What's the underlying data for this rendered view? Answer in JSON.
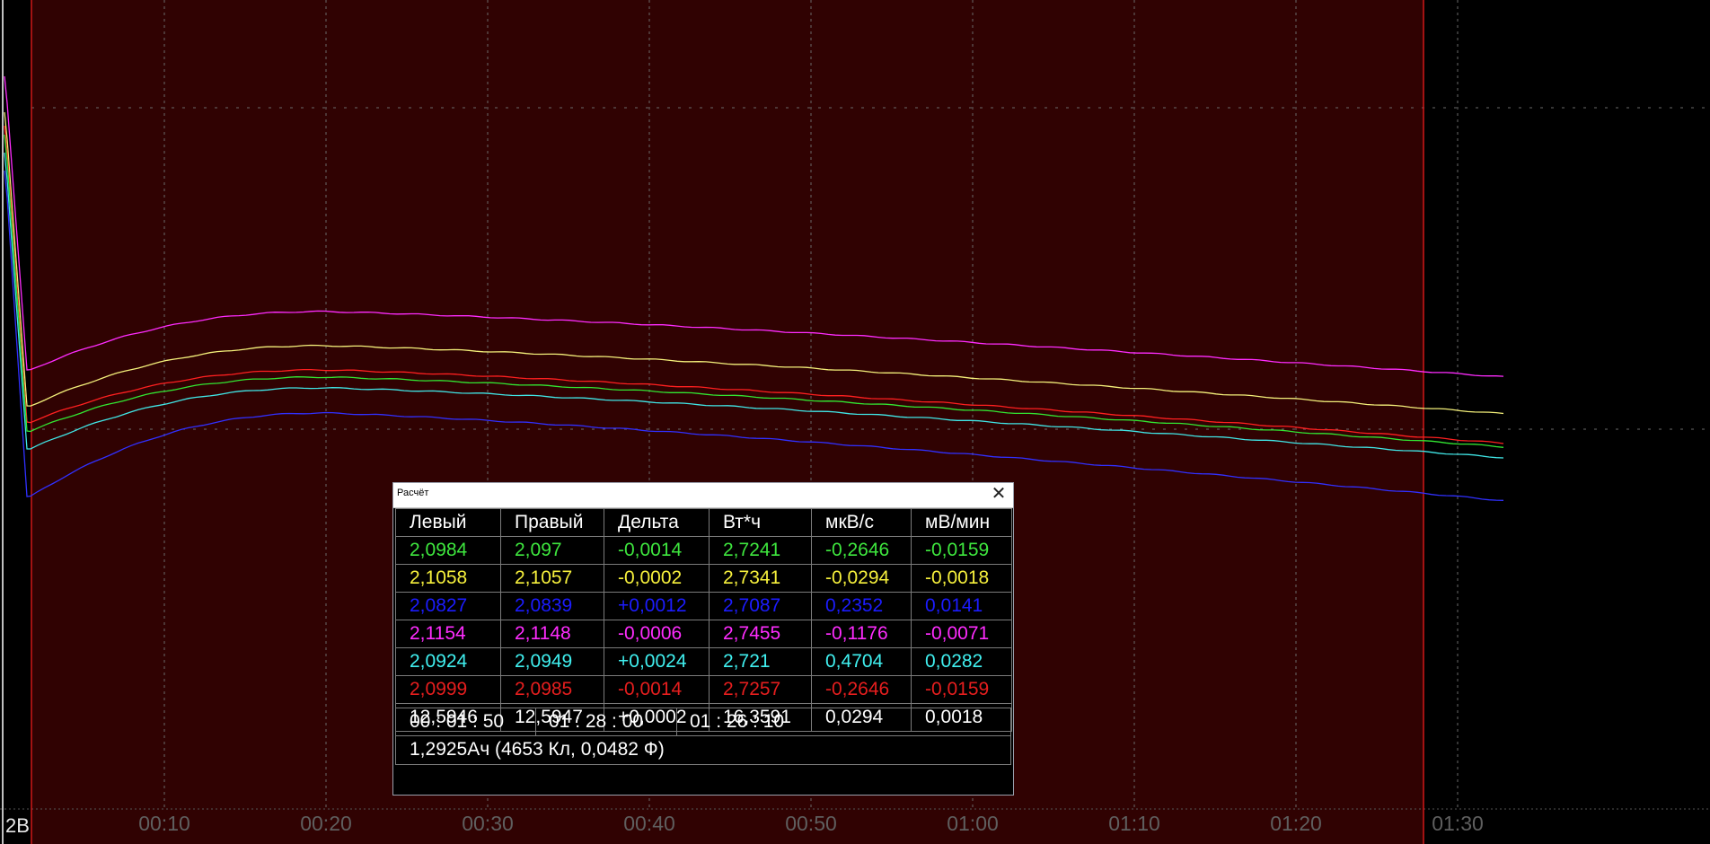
{
  "chart_data": {
    "type": "line",
    "x_ticks": [
      "00:10",
      "00:20",
      "00:30",
      "00:40",
      "00:50",
      "01:00",
      "01:10",
      "01:20",
      "01:30"
    ],
    "scale_label": "2В",
    "selection_range": [
      "00:01:50",
      "01:28:00"
    ],
    "grid": true,
    "series_colors": [
      "#ff2cff",
      "#f4f07a",
      "#ff2020",
      "#32e632",
      "#40e6e6",
      "#3030ff"
    ]
  },
  "calc": {
    "title": "Расчёт",
    "headers": [
      "Левый",
      "Правый",
      "Дельта",
      "Вт*ч",
      "мкВ/с",
      "мВ/мин"
    ],
    "rows": [
      {
        "color": "#3ee63e",
        "cells": [
          "2,0984",
          "2,097",
          "-0,0014",
          "2,7241",
          "-0,2646",
          "-0,0159"
        ]
      },
      {
        "color": "#f6f03c",
        "cells": [
          "2,1058",
          "2,1057",
          "-0,0002",
          "2,7341",
          "-0,0294",
          "-0,0018"
        ]
      },
      {
        "color": "#1c1cff",
        "cells": [
          "2,0827",
          "2,0839",
          "+0,0012",
          "2,7087",
          "0,2352",
          "0,0141"
        ]
      },
      {
        "color": "#ff2cff",
        "cells": [
          "2,1154",
          "2,1148",
          "-0,0006",
          "2,7455",
          "-0,1176",
          "-0,0071"
        ]
      },
      {
        "color": "#40f0f0",
        "cells": [
          "2,0924",
          "2,0949",
          "+0,0024",
          "2,721",
          "0,4704",
          "0,0282"
        ]
      },
      {
        "color": "#e61e1e",
        "cells": [
          "2,0999",
          "2,0985",
          "-0,0014",
          "2,7257",
          "-0,2646",
          "-0,0159"
        ]
      },
      {
        "color": "#ffffff",
        "cells": [
          "12,5946",
          "12,5947",
          "+0,0002",
          "16,3591",
          "0,0294",
          "0,0018"
        ]
      }
    ],
    "times": [
      "00 : 01 : 50",
      "01 : 28 : 00",
      "01 : 26 : 10"
    ],
    "charge": "1,2925Ач (4653 Кл, 0,0482 Ф)"
  }
}
